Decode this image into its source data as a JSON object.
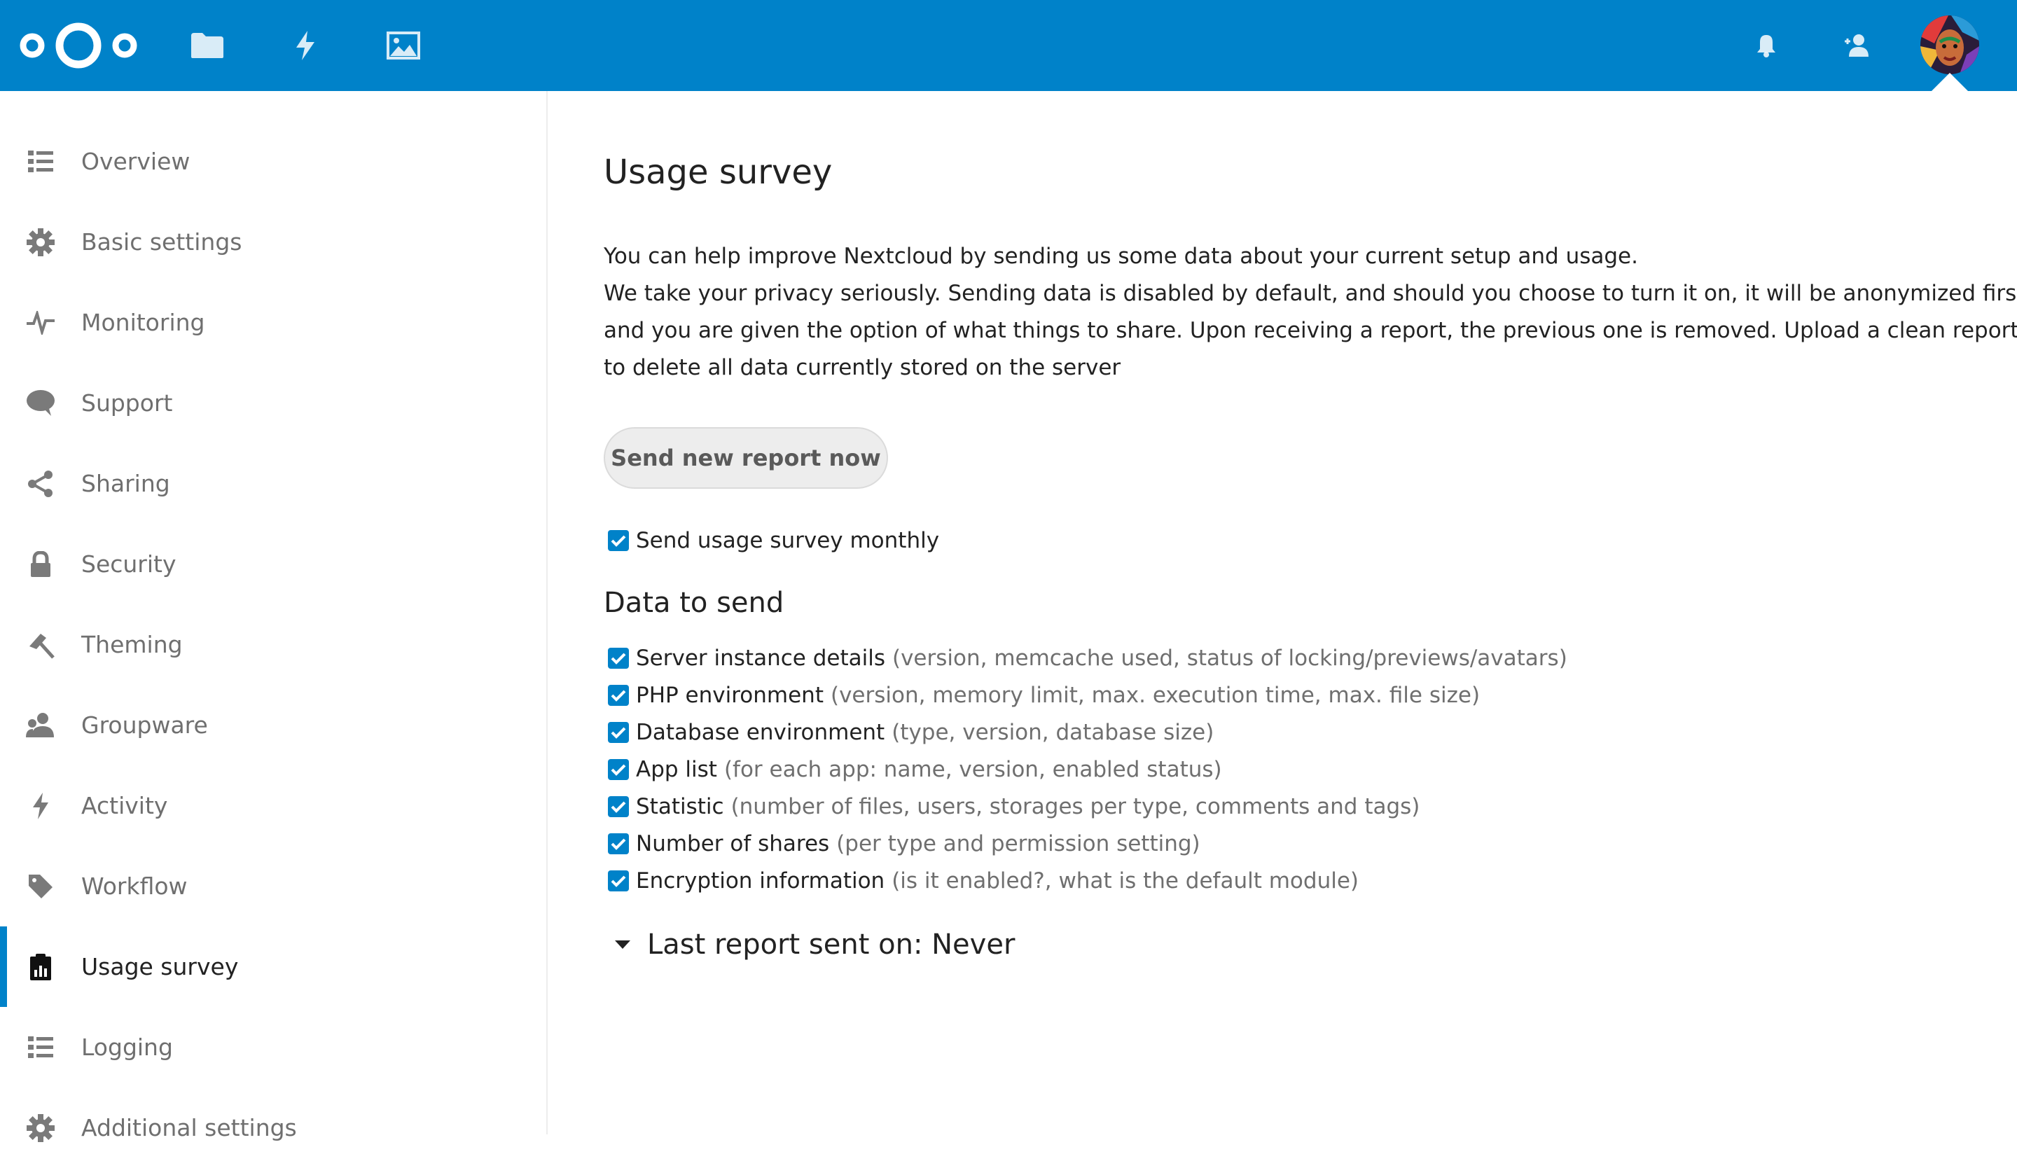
{
  "header": {
    "logo_icon": "nextcloud-logo-icon",
    "apps": [
      {
        "name": "files",
        "icon": "folder-icon"
      },
      {
        "name": "activity",
        "icon": "lightning-icon"
      },
      {
        "name": "gallery",
        "icon": "image-icon"
      }
    ],
    "right": [
      {
        "name": "notifications",
        "icon": "bell-icon"
      },
      {
        "name": "contacts",
        "icon": "contacts-icon"
      }
    ],
    "accent_color": "#0082c9"
  },
  "sidebar": {
    "items": [
      {
        "label": "Overview",
        "icon": "list-icon"
      },
      {
        "label": "Basic settings",
        "icon": "gear-icon"
      },
      {
        "label": "Monitoring",
        "icon": "pulse-icon"
      },
      {
        "label": "Support",
        "icon": "speech-bubble-icon"
      },
      {
        "label": "Sharing",
        "icon": "share-icon"
      },
      {
        "label": "Security",
        "icon": "lock-icon"
      },
      {
        "label": "Theming",
        "icon": "brush-icon"
      },
      {
        "label": "Groupware",
        "icon": "group-icon"
      },
      {
        "label": "Activity",
        "icon": "lightning-icon"
      },
      {
        "label": "Workflow",
        "icon": "tag-icon"
      },
      {
        "label": "Usage survey",
        "icon": "clipboard-chart-icon",
        "active": true
      },
      {
        "label": "Logging",
        "icon": "list-icon"
      },
      {
        "label": "Additional settings",
        "icon": "gear-icon"
      }
    ]
  },
  "main": {
    "title": "Usage survey",
    "paragraph": [
      "You can help improve Nextcloud by sending us some data about your current setup and usage.",
      "We take your privacy seriously. Sending data is disabled by default, and should you choose to turn it on, it will be anonymized first,",
      "and you are given the option of what things to share. Upon receiving a report, the previous one is removed. Upload a clean report",
      "to delete all data currently stored on the server"
    ],
    "send_button": "Send new report now",
    "monthly_label": "Send usage survey monthly",
    "monthly_checked": true,
    "data_heading": "Data to send",
    "data_items": [
      {
        "label": "Server instance details",
        "desc": "(version, memcache used, status of locking/previews/avatars)",
        "checked": true
      },
      {
        "label": "PHP environment",
        "desc": "(version, memory limit, max. execution time, max. file size)",
        "checked": true
      },
      {
        "label": "Database environment",
        "desc": "(type, version, database size)",
        "checked": true
      },
      {
        "label": "App list",
        "desc": "(for each app: name, version, enabled status)",
        "checked": true
      },
      {
        "label": "Statistic",
        "desc": "(number of files, users, storages per type, comments and tags)",
        "checked": true
      },
      {
        "label": "Number of shares",
        "desc": "(per type and permission setting)",
        "checked": true
      },
      {
        "label": "Encryption information",
        "desc": "(is it enabled?, what is the default module)",
        "checked": true
      }
    ],
    "last_report": "Last report sent on: Never"
  }
}
